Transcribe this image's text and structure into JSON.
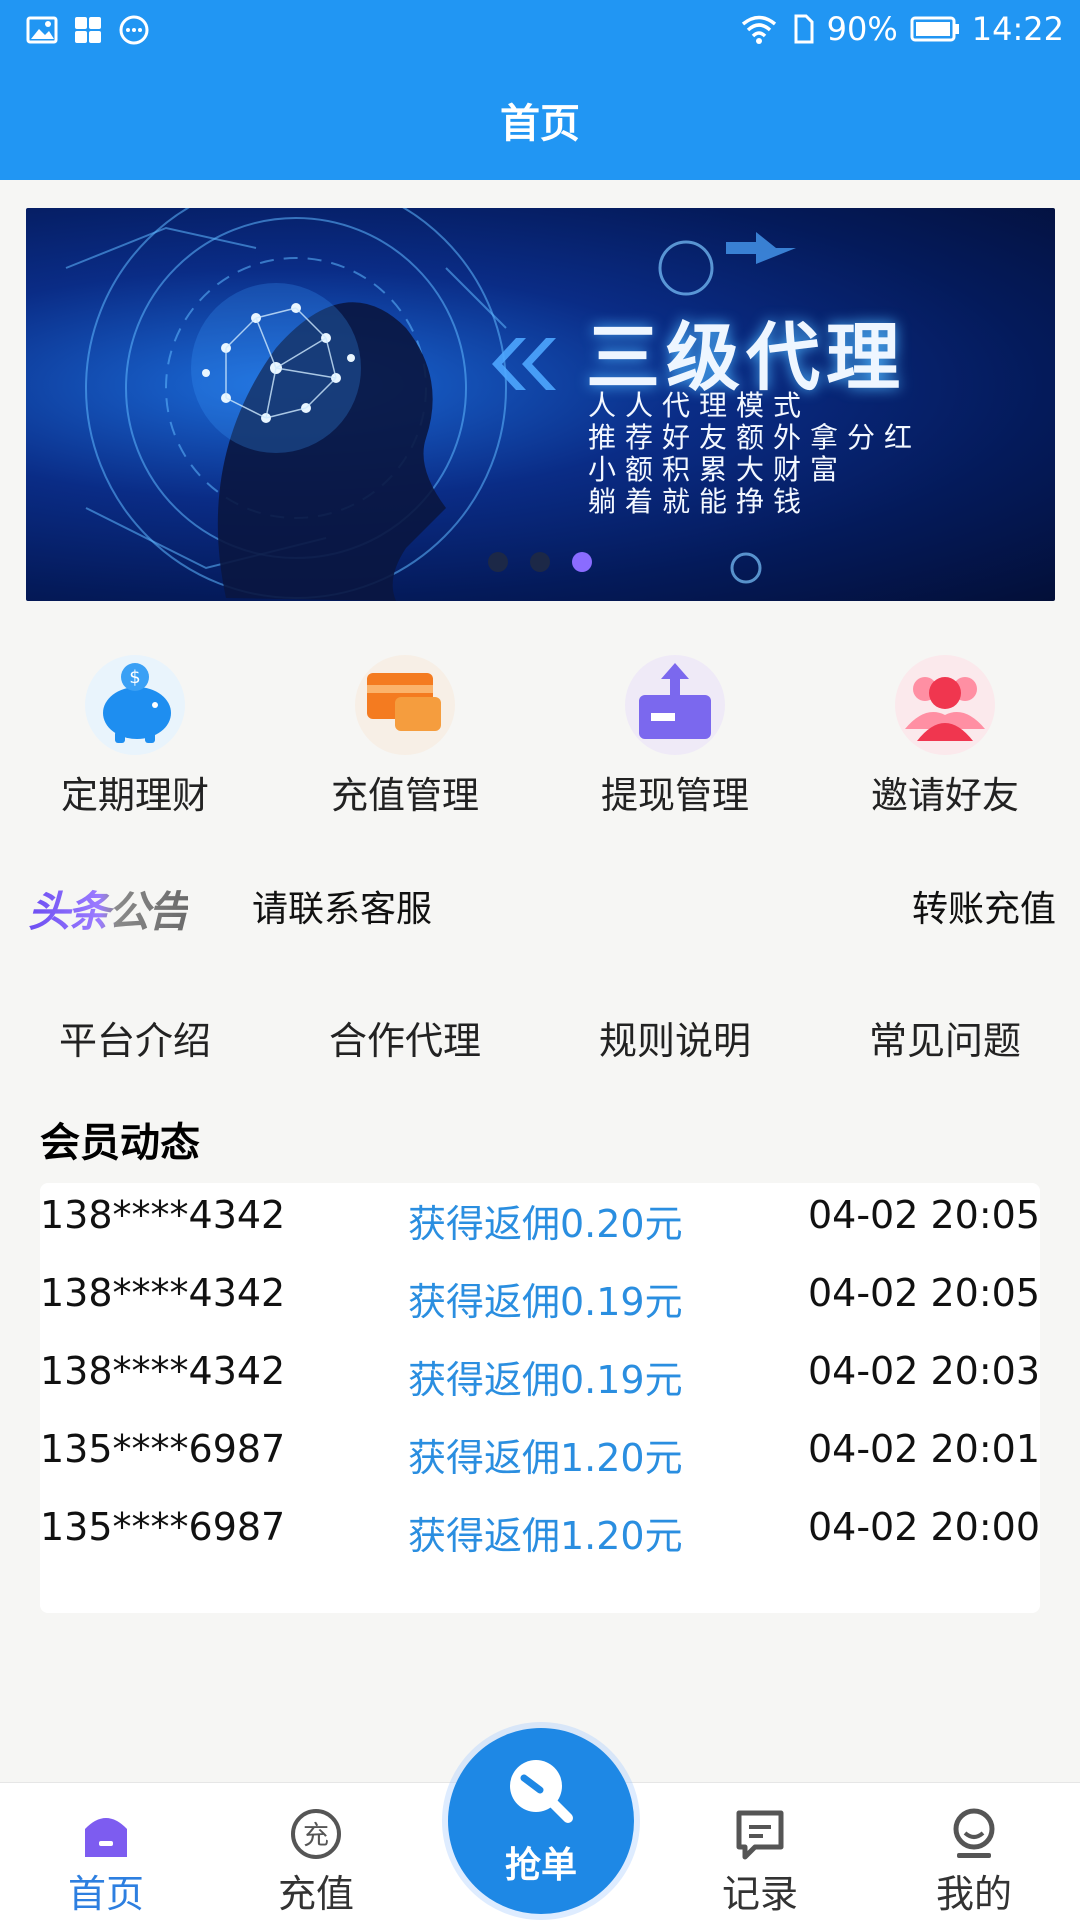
{
  "status_bar": {
    "battery": "90%",
    "time": "14:22",
    "left_icons": [
      "image-icon",
      "apps-icon",
      "chat-icon"
    ],
    "right_icons": [
      "wifi-icon",
      "sim-icon",
      "battery-icon"
    ]
  },
  "header": {
    "title": "首页"
  },
  "banner": {
    "title": "三级代理",
    "lines": [
      "人人代理模式",
      "推荐好友额外拿分红",
      "小额积累大财富",
      "躺着就能挣钱"
    ],
    "slide_count": 3,
    "active_slide": 3
  },
  "menu": [
    {
      "label": "定期理财",
      "icon": "piggy-bank-icon"
    },
    {
      "label": "充值管理",
      "icon": "card-icon"
    },
    {
      "label": "提现管理",
      "icon": "withdraw-icon"
    },
    {
      "label": "邀请好友",
      "icon": "friends-icon"
    }
  ],
  "notice": {
    "logo": "头条公告",
    "text": "请联系客服",
    "right_text": "转账充值"
  },
  "links": [
    "平台介绍",
    "合作代理",
    "规则说明",
    "常见问题"
  ],
  "member_feed": {
    "title": "会员动态",
    "rows": [
      {
        "phone": "138****4342",
        "message": "获得返佣0.20元",
        "time": "04-02 20:05"
      },
      {
        "phone": "138****4342",
        "message": "获得返佣0.19元",
        "time": "04-02 20:05"
      },
      {
        "phone": "138****4342",
        "message": "获得返佣0.19元",
        "time": "04-02 20:03"
      },
      {
        "phone": "135****6987",
        "message": "获得返佣1.20元",
        "time": "04-02 20:01"
      },
      {
        "phone": "135****6987",
        "message": "获得返佣1.20元",
        "time": "04-02 20:00"
      }
    ]
  },
  "tabbar": {
    "tabs": [
      {
        "label": "首页",
        "icon": "home-icon",
        "active": true
      },
      {
        "label": "充值",
        "icon": "recharge-icon",
        "active": false
      },
      {
        "label": "记录",
        "icon": "record-icon",
        "active": false
      },
      {
        "label": "我的",
        "icon": "profile-icon",
        "active": false
      }
    ],
    "center": {
      "label": "抢单",
      "icon": "search-grab-icon"
    }
  },
  "colors": {
    "primary": "#2196f3",
    "accent_text": "#2a8ee0",
    "active_tab": "#2d7fe0",
    "dot_active": "#8a6cff"
  }
}
